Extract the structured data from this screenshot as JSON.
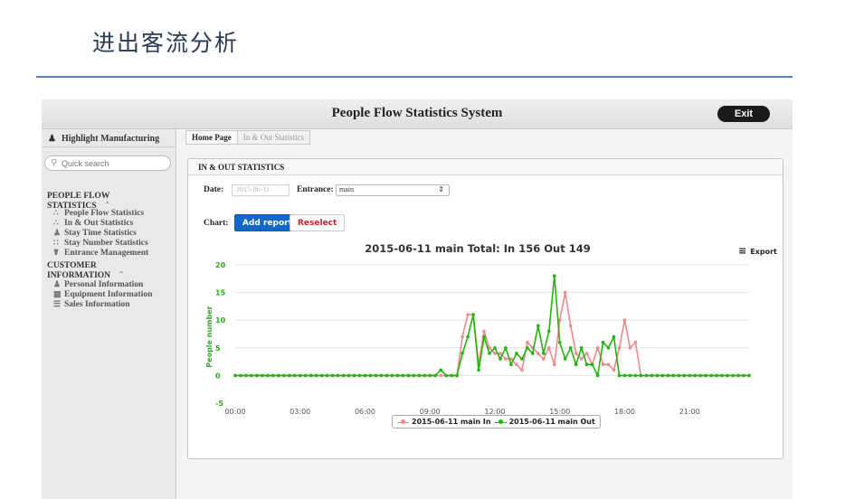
{
  "doc_title": "进出客流分析",
  "topbar": {
    "title": "People Flow Statistics System",
    "exit_label": "Exit"
  },
  "sidebar": {
    "company": "Highlight Manufacturing",
    "search_placeholder": "Quick search",
    "groups": [
      {
        "title": "PEOPLE FLOW STATISTICS",
        "items": [
          "People Flow Statistics",
          "In & Out Statistics",
          "Stay Time Statistics",
          "Stay Number Statistics",
          "Entrance Management"
        ]
      },
      {
        "title": "CUSTOMER INFORMATION",
        "items": [
          "Personal Information",
          "Equipment Information",
          "Sales Information"
        ]
      }
    ]
  },
  "breadcrumb": {
    "home": "Home Page",
    "current": "In & Out Statistics"
  },
  "panel": {
    "title": "IN & OUT STATISTICS",
    "date_label": "Date:",
    "date_value": "2015-06-11",
    "entrance_label": "Entrance:",
    "entrance_value": "main",
    "chart_label": "Chart:",
    "add_report_label": "Add report",
    "reselect_label": "Reselect",
    "export_label": "Export"
  },
  "colors": {
    "in": "#f08a8f",
    "out": "#22b30f",
    "axis_title": "#3aa832",
    "primary_button": "#1268c8"
  },
  "chart_data": {
    "type": "line",
    "title": "2015-06-11 main Total:  In 156 Out 149",
    "xlabel": "",
    "ylabel": "People number",
    "x_range": [
      0,
      23.75
    ],
    "x_ticks": [
      "00:00",
      "03:00",
      "06:00",
      "09:00",
      "12:00",
      "15:00",
      "18:00",
      "21:00"
    ],
    "ylim": [
      -5,
      20
    ],
    "y_ticks": [
      -5,
      0,
      5,
      10,
      15,
      20
    ],
    "grid": true,
    "legend": "bottom",
    "interval_minutes": 15,
    "series": [
      {
        "name": "2015-06-11 main In",
        "color": "#f08a8f",
        "values": [
          0,
          0,
          0,
          0,
          0,
          0,
          0,
          0,
          0,
          0,
          0,
          0,
          0,
          0,
          0,
          0,
          0,
          0,
          0,
          0,
          0,
          0,
          0,
          0,
          0,
          0,
          0,
          0,
          0,
          0,
          0,
          0,
          0,
          0,
          0,
          0,
          0,
          0,
          0,
          0,
          0,
          0,
          7,
          11,
          11,
          2,
          8,
          5,
          4,
          4,
          3,
          3,
          2,
          1,
          6,
          5,
          4,
          3,
          5,
          2,
          10,
          15,
          9,
          4,
          3,
          4,
          2,
          5,
          2,
          2,
          1,
          5,
          10,
          5,
          6,
          0,
          0,
          0,
          0,
          0,
          0,
          0,
          0,
          0,
          0,
          0,
          0,
          0,
          0,
          0,
          0,
          0,
          0,
          0,
          0,
          0
        ]
      },
      {
        "name": "2015-06-11 main Out",
        "color": "#22b30f",
        "values": [
          0,
          0,
          0,
          0,
          0,
          0,
          0,
          0,
          0,
          0,
          0,
          0,
          0,
          0,
          0,
          0,
          0,
          0,
          0,
          0,
          0,
          0,
          0,
          0,
          0,
          0,
          0,
          0,
          0,
          0,
          0,
          0,
          0,
          0,
          0,
          0,
          0,
          0,
          1,
          0,
          0,
          0,
          4,
          7,
          11,
          1,
          7,
          4,
          5,
          3,
          5,
          2,
          4,
          3,
          5,
          4,
          9,
          4,
          8,
          18,
          6,
          3,
          5,
          2,
          5,
          2,
          2,
          0,
          6,
          5,
          7,
          0,
          0,
          0,
          0,
          0,
          0,
          0,
          0,
          0,
          0,
          0,
          0,
          0,
          0,
          0,
          0,
          0,
          0,
          0,
          0,
          0,
          0,
          0,
          0,
          0
        ]
      }
    ]
  }
}
